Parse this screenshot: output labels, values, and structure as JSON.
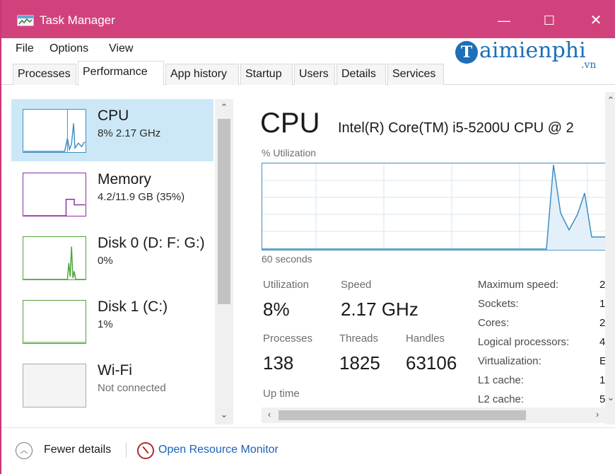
{
  "window": {
    "title": "Task Manager",
    "controls": {
      "minimize": "—",
      "maximize": "☐",
      "close": "✕"
    },
    "accent_color": "#d1427d"
  },
  "menu": [
    "File",
    "Options",
    "View"
  ],
  "watermark": {
    "logo_letter": "T",
    "text": "aimienphi",
    "suffix": ".vn"
  },
  "tabs": [
    "Processes",
    "Performance",
    "App history",
    "Startup",
    "Users",
    "Details",
    "Services"
  ],
  "active_tab": "Performance",
  "sidebar": {
    "items": [
      {
        "name": "CPU",
        "value": "8% 2.17 GHz",
        "color": "#3e8ec2",
        "selected": true
      },
      {
        "name": "Memory",
        "value": "4.2/11.9 GB (35%)",
        "color": "#8b2fa8",
        "selected": false
      },
      {
        "name": "Disk 0 (D: F: G:)",
        "value": "0%",
        "color": "#4ea43a",
        "selected": false
      },
      {
        "name": "Disk 1 (C:)",
        "value": "1%",
        "color": "#4ea43a",
        "selected": false
      },
      {
        "name": "Wi-Fi",
        "value": "Not connected",
        "color": "#aaaaaa",
        "selected": false
      }
    ],
    "scroll_up_icon": "chevron-up-icon",
    "scroll_down_icon": "chevron-down-icon"
  },
  "main": {
    "title": "CPU",
    "cpu_model": "Intel(R) Core(TM) i5-5200U CPU @ 2",
    "util_label": "% Utilization",
    "graph_duration_label": "60 seconds",
    "stats": {
      "utilization": {
        "label": "Utilization",
        "value": "8%"
      },
      "speed": {
        "label": "Speed",
        "value": "2.17 GHz"
      },
      "processes": {
        "label": "Processes",
        "value": "138"
      },
      "threads": {
        "label": "Threads",
        "value": "1825"
      },
      "handles": {
        "label": "Handles",
        "value": "63106"
      },
      "uptime": {
        "label": "Up time"
      }
    },
    "details": [
      {
        "label": "Maximum speed:",
        "value": "2"
      },
      {
        "label": "Sockets:",
        "value": "1"
      },
      {
        "label": "Cores:",
        "value": "2"
      },
      {
        "label": "Logical processors:",
        "value": "4"
      },
      {
        "label": "Virtualization:",
        "value": "E"
      },
      {
        "label": "L1 cache:",
        "value": "1"
      },
      {
        "label": "L2 cache:",
        "value": "5"
      }
    ]
  },
  "footer": {
    "fewer_details": "Fewer details",
    "open_resource_monitor": "Open Resource Monitor"
  }
}
